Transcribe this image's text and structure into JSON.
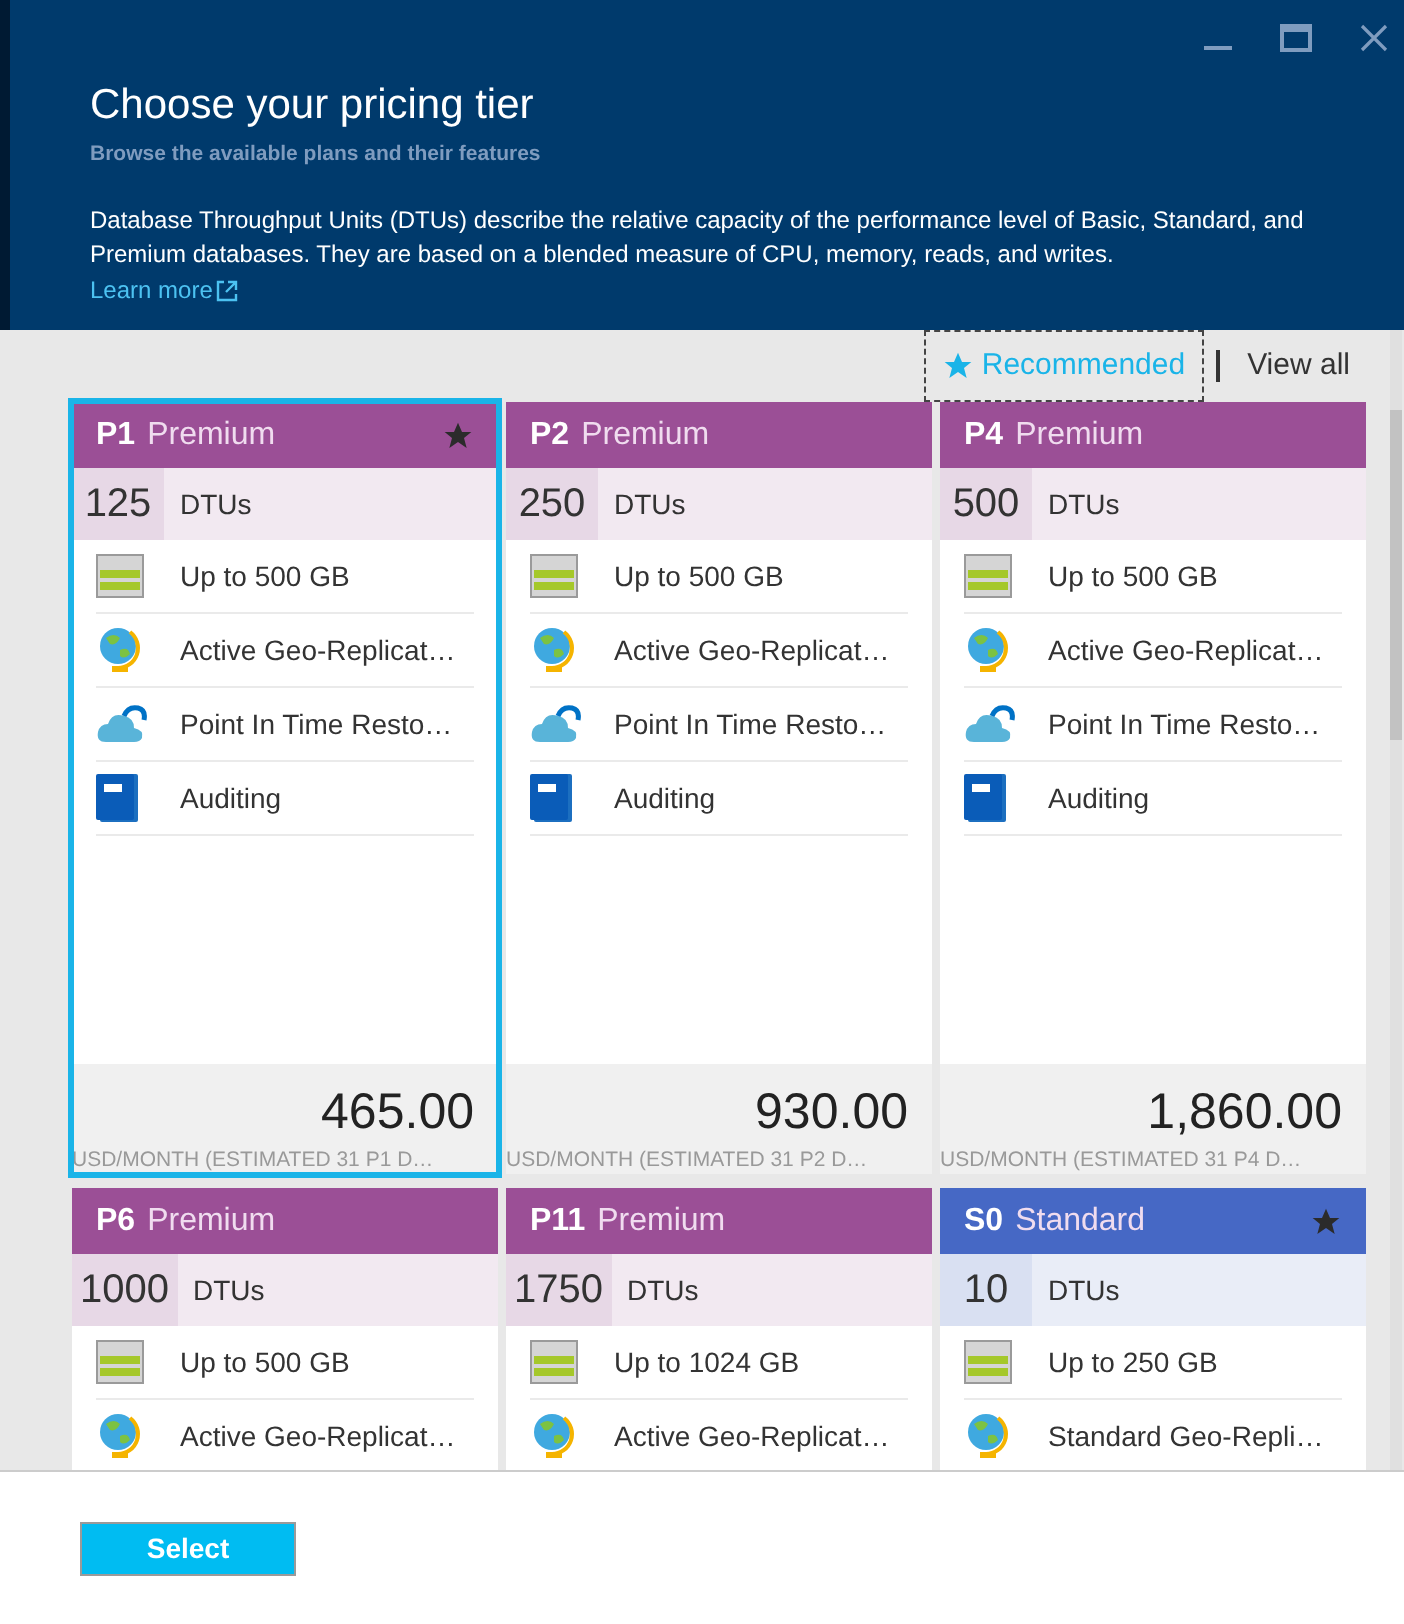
{
  "window": {
    "title": "Choose your pricing tier",
    "subtitle": "Browse the available plans and their features",
    "description": "Database Throughput Units (DTUs) describe the relative capacity of the performance level of Basic, Standard, and Premium databases. They are based on a blended measure of CPU, memory, reads, and writes.",
    "link": "Learn more"
  },
  "filters": [
    {
      "label": "Recommended",
      "selected": true
    },
    {
      "label": "View all",
      "selected": false
    }
  ],
  "cards": [
    {
      "code": "P1",
      "tier": "Premium",
      "kind": "premium",
      "recommended": true,
      "selected": true,
      "dtus": "125",
      "dtu_label": "DTUs",
      "features": [
        {
          "kind": "storage",
          "text": "Up to 500 GB"
        },
        {
          "kind": "geo",
          "text": "Active Geo-Replicat…"
        },
        {
          "kind": "restore",
          "text": "Point In Time Resto…"
        },
        {
          "kind": "audit",
          "text": "Auditing"
        }
      ],
      "price": "465.00",
      "price_note": "USD/MONTH (ESTIMATED 31 P1 D…"
    },
    {
      "code": "P2",
      "tier": "Premium",
      "kind": "premium",
      "recommended": false,
      "selected": false,
      "dtus": "250",
      "dtu_label": "DTUs",
      "features": [
        {
          "kind": "storage",
          "text": "Up to 500 GB"
        },
        {
          "kind": "geo",
          "text": "Active Geo-Replicat…"
        },
        {
          "kind": "restore",
          "text": "Point In Time Resto…"
        },
        {
          "kind": "audit",
          "text": "Auditing"
        }
      ],
      "price": "930.00",
      "price_note": "USD/MONTH (ESTIMATED 31 P2 D…"
    },
    {
      "code": "P4",
      "tier": "Premium",
      "kind": "premium",
      "recommended": false,
      "selected": false,
      "dtus": "500",
      "dtu_label": "DTUs",
      "features": [
        {
          "kind": "storage",
          "text": "Up to 500 GB"
        },
        {
          "kind": "geo",
          "text": "Active Geo-Replicat…"
        },
        {
          "kind": "restore",
          "text": "Point In Time Resto…"
        },
        {
          "kind": "audit",
          "text": "Auditing"
        }
      ],
      "price": "1,860.00",
      "price_note": "USD/MONTH (ESTIMATED 31 P4 D…"
    },
    {
      "code": "P6",
      "tier": "Premium",
      "kind": "premium",
      "recommended": false,
      "selected": false,
      "dtus": "1000",
      "dtu_label": "DTUs",
      "features": [
        {
          "kind": "storage",
          "text": "Up to 500 GB"
        },
        {
          "kind": "geo",
          "text": "Active Geo-Replicat…"
        }
      ]
    },
    {
      "code": "P11",
      "tier": "Premium",
      "kind": "premium",
      "recommended": false,
      "selected": false,
      "dtus": "1750",
      "dtu_label": "DTUs",
      "features": [
        {
          "kind": "storage",
          "text": "Up to 1024 GB"
        },
        {
          "kind": "geo",
          "text": "Active Geo-Replicat…"
        }
      ]
    },
    {
      "code": "S0",
      "tier": "Standard",
      "kind": "standard",
      "recommended": true,
      "selected": false,
      "dtus": "10",
      "dtu_label": "DTUs",
      "features": [
        {
          "kind": "storage",
          "text": "Up to 250 GB"
        },
        {
          "kind": "geo",
          "text": "Standard Geo-Repli…"
        }
      ]
    }
  ],
  "footer": {
    "button": "Select"
  }
}
